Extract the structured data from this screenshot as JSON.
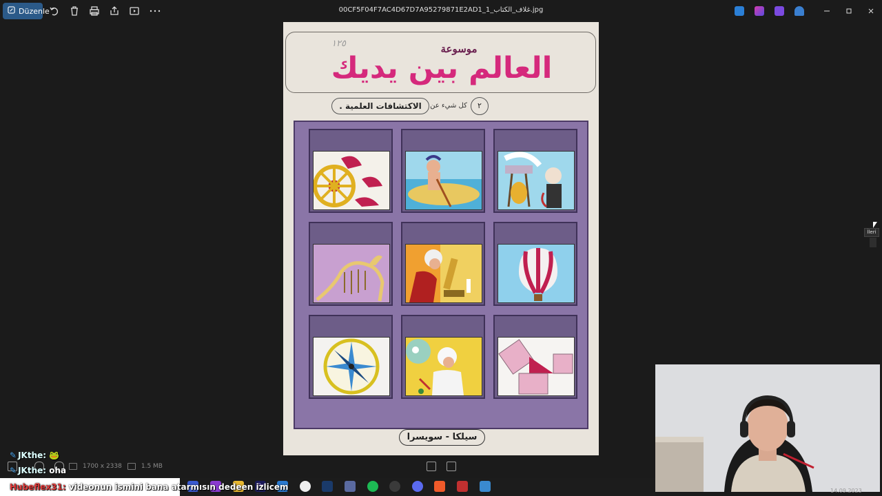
{
  "toolbar": {
    "edit_label": "Düzenle"
  },
  "window": {
    "title": "00CF5F04F7AC4D67D7A95279871E2AD1_1_غلاف_الكتاب.jpg"
  },
  "cover": {
    "series_label": "موسوعة",
    "handwritten_number": "١٢٥",
    "title": "العالم بين يديك",
    "volume_number": "٢",
    "everything_about": "كل شيء عن",
    "subject": "الاكتشافات العلمية .",
    "publisher": "سيلكا - سويسرا"
  },
  "status": {
    "dimensions": "1700 x 2338",
    "file_size": "1.5 MB"
  },
  "side_tooltip": "İleri",
  "chat": {
    "messages": [
      {
        "user": "JKthe:",
        "text": "🐸"
      },
      {
        "user": "JKthe:",
        "text": "oha"
      }
    ],
    "highlight": {
      "user": "Hubeflex31:",
      "text": " videonun ismini bana atarmısın dedeen izlicem"
    }
  },
  "clock": "14.09.2023",
  "colors": {
    "accent": "#2b5a89",
    "title_pink": "#d5297c",
    "shelf_purple": "#8a75a7"
  }
}
